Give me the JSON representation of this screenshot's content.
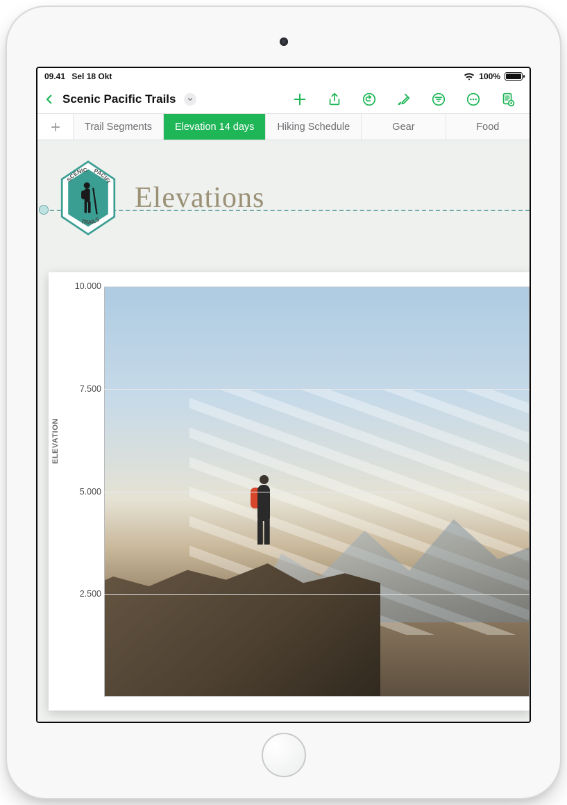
{
  "status": {
    "time": "09.41",
    "date": "Sel 18 Okt",
    "battery_pct": "100%"
  },
  "toolbar": {
    "doc_title": "Scenic Pacific Trails"
  },
  "tabs": [
    {
      "label": "Trail Segments",
      "active": false
    },
    {
      "label": "Elevation 14 days",
      "active": true
    },
    {
      "label": "Hiking Schedule",
      "active": false
    },
    {
      "label": "Gear",
      "active": false
    },
    {
      "label": "Food",
      "active": false
    }
  ],
  "logo": {
    "top_text": "SCENIC",
    "right_text": "PACIFIC",
    "bottom_text": "TRAILS"
  },
  "page_title": "Elevations",
  "chart_data": {
    "type": "other",
    "title": "Elevations",
    "ylabel": "ELEVATION",
    "ylim": [
      0,
      10000
    ],
    "yticks": [
      2500,
      5000,
      7500,
      10000
    ],
    "ytick_labels": [
      "2.500",
      "5.000",
      "7.500",
      "10.000"
    ],
    "note": "Chart area shows a background photograph of a hiker overlooking mountains; no plotted series are visible in the screenshot.",
    "series": []
  }
}
